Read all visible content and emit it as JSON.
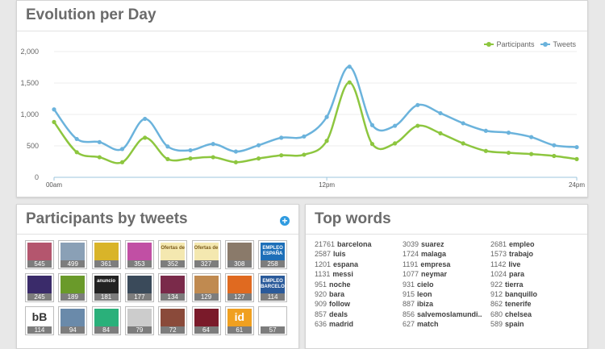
{
  "evolution": {
    "title": "Evolution per Day",
    "legend": [
      "Participants",
      "Tweets"
    ]
  },
  "participants": {
    "title": "Participants by tweets",
    "plus": "+",
    "tiles": [
      {
        "count": "545",
        "bg": "#b4566e"
      },
      {
        "count": "499",
        "bg": "#8aa0b6"
      },
      {
        "count": "361",
        "bg": "#d9b429"
      },
      {
        "count": "353",
        "bg": "#c14fa4"
      },
      {
        "count": "352",
        "bg": "#f4e8b0",
        "label": "Ofertas de"
      },
      {
        "count": "327",
        "bg": "#f4e8b0",
        "label": "Ofertas de"
      },
      {
        "count": "308",
        "bg": "#8a7a6a"
      },
      {
        "count": "258",
        "bg": "#1d6fb8",
        "label": "EMPLEO ESPAÑA"
      },
      {
        "count": "245",
        "bg": "#3a2b6a"
      },
      {
        "count": "189",
        "bg": "#6a9a2a"
      },
      {
        "count": "181",
        "bg": "#222222",
        "label": "anuncio"
      },
      {
        "count": "177",
        "bg": "#3a4a5a"
      },
      {
        "count": "134",
        "bg": "#7a2a4a"
      },
      {
        "count": "129",
        "bg": "#c08a50"
      },
      {
        "count": "127",
        "bg": "#e06a20"
      },
      {
        "count": "114",
        "bg": "#2a5a9a",
        "label": "EMPLEO BARCELONA"
      },
      {
        "count": "114",
        "bg": "#ffffff",
        "label": "bB"
      },
      {
        "count": "94",
        "bg": "#6a8aaa"
      },
      {
        "count": "84",
        "bg": "#2ab07a"
      },
      {
        "count": "79",
        "bg": "#cccccc"
      },
      {
        "count": "72",
        "bg": "#8a4a3a"
      },
      {
        "count": "64",
        "bg": "#7a1a2a"
      },
      {
        "count": "61",
        "bg": "#f0a020",
        "label": "id"
      },
      {
        "count": "57",
        "bg": "#ffffff"
      }
    ]
  },
  "topwords": {
    "title": "Top words",
    "columns": [
      [
        [
          "21761",
          "barcelona"
        ],
        [
          "2587",
          "luis"
        ],
        [
          "1201",
          "espana"
        ],
        [
          "1131",
          "messi"
        ],
        [
          "951",
          "noche"
        ],
        [
          "920",
          "bara"
        ],
        [
          "909",
          "follow"
        ],
        [
          "857",
          "deals"
        ],
        [
          "636",
          "madrid"
        ]
      ],
      [
        [
          "3039",
          "suarez"
        ],
        [
          "1724",
          "malaga"
        ],
        [
          "1191",
          "empresa"
        ],
        [
          "1077",
          "neymar"
        ],
        [
          "931",
          "cielo"
        ],
        [
          "915",
          "leon"
        ],
        [
          "887",
          "ibiza"
        ],
        [
          "856",
          "salvemoslamundi.."
        ],
        [
          "627",
          "match"
        ]
      ],
      [
        [
          "2681",
          "empleo"
        ],
        [
          "1573",
          "trabajo"
        ],
        [
          "1142",
          "live"
        ],
        [
          "1024",
          "para"
        ],
        [
          "922",
          "tierra"
        ],
        [
          "912",
          "banquillo"
        ],
        [
          "862",
          "tenerife"
        ],
        [
          "680",
          "chelsea"
        ],
        [
          "589",
          "spain"
        ]
      ]
    ]
  },
  "colors": {
    "participants": "#8dc63f",
    "tweets": "#6bb3dc"
  },
  "chart_data": {
    "type": "line",
    "title": "Evolution per Day",
    "x": [
      0,
      1,
      2,
      3,
      4,
      5,
      6,
      7,
      8,
      9,
      10,
      11,
      12,
      13,
      14,
      15,
      16,
      17,
      18,
      19,
      20,
      21,
      22,
      23
    ],
    "xticks": [
      {
        "pos": 0,
        "label": "00am"
      },
      {
        "pos": 12,
        "label": "12pm"
      },
      {
        "pos": 23,
        "label": "24pm"
      }
    ],
    "ylim": [
      0,
      2000
    ],
    "yticks": [
      "0",
      "500",
      "1,000",
      "1,500",
      "2,000"
    ],
    "series": [
      {
        "name": "Participants",
        "values": [
          880,
          400,
          320,
          240,
          630,
          290,
          300,
          320,
          240,
          300,
          350,
          360,
          580,
          1510,
          530,
          540,
          820,
          700,
          540,
          420,
          390,
          370,
          340,
          290
        ]
      },
      {
        "name": "Tweets",
        "values": [
          1080,
          610,
          560,
          450,
          930,
          490,
          430,
          530,
          410,
          510,
          630,
          650,
          960,
          1760,
          830,
          820,
          1150,
          1020,
          860,
          740,
          710,
          640,
          510,
          480
        ]
      }
    ]
  }
}
